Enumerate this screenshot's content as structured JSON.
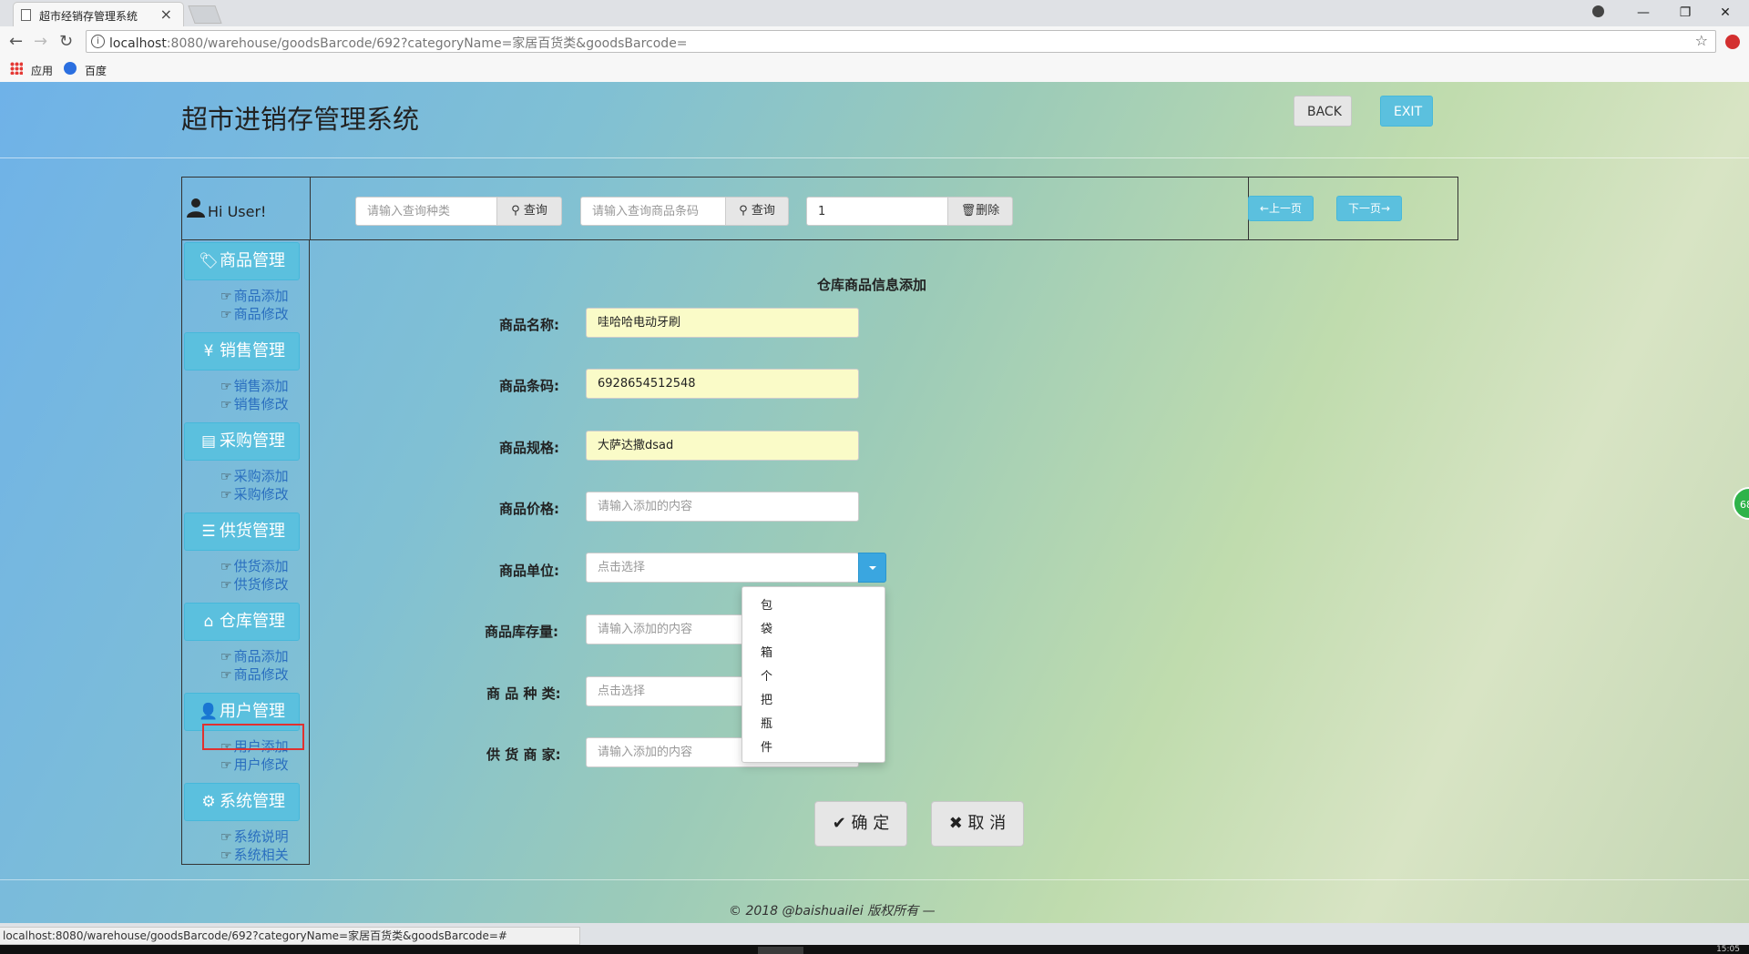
{
  "browser": {
    "tab_title": "超市经销存管理系统",
    "url_host": "localhost",
    "url_rest": ":8080/warehouse/goodsBarcode/692?categoryName=家居百货类&goodsBarcode=",
    "bookmarks": [
      "应用",
      "百度"
    ],
    "status_url": "localhost:8080/warehouse/goodsBarcode/692?categoryName=家居百货类&goodsBarcode=#",
    "clock": "15:05"
  },
  "header": {
    "title": "超市进销存管理系统",
    "back_label": "BACK",
    "exit_label": "EXIT"
  },
  "topbar": {
    "greeting": "Hi User!",
    "search_category_placeholder": "请输入查询种类",
    "search_category_button": "查询",
    "search_barcode_placeholder": "请输入查询商品条码",
    "search_barcode_button": "查询",
    "delete_value": "1",
    "delete_button": "删除",
    "prev_page": "上一页",
    "next_page": "下一页"
  },
  "sidebar": {
    "groups": [
      {
        "title": "商品管理",
        "icon": "tag-icon",
        "links": [
          "商品添加",
          "商品修改"
        ]
      },
      {
        "title": "销售管理",
        "icon": "yen-icon",
        "links": [
          "销售添加",
          "销售修改"
        ]
      },
      {
        "title": "采购管理",
        "icon": "list-alt-icon",
        "links": [
          "采购添加",
          "采购修改"
        ]
      },
      {
        "title": "供货管理",
        "icon": "list-icon",
        "links": [
          "供货添加",
          "供货修改"
        ]
      },
      {
        "title": "仓库管理",
        "icon": "home-icon",
        "links": [
          "商品添加",
          "商品修改"
        ]
      },
      {
        "title": "用户管理",
        "icon": "user-icon",
        "links": [
          "用户添加",
          "用户修改"
        ]
      },
      {
        "title": "系统管理",
        "icon": "cog-icon",
        "links": [
          "系统说明",
          "系统相关"
        ]
      }
    ]
  },
  "form": {
    "title": "仓库商品信息添加",
    "fields": [
      {
        "label": "商品名称:",
        "value": "哇哈哈电动牙刷",
        "placeholder": ""
      },
      {
        "label": "商品条码:",
        "value": "6928654512548",
        "placeholder": ""
      },
      {
        "label": "商品规格:",
        "value": "大萨达撒dsad",
        "placeholder": ""
      },
      {
        "label": "商品价格:",
        "value": "",
        "placeholder": "请输入添加的内容"
      },
      {
        "label": "商品单位:",
        "value": "",
        "placeholder": "点击选择"
      },
      {
        "label": "商品库存量:",
        "value": "",
        "placeholder": "请输入添加的内容"
      },
      {
        "label": "商 品 种 类:",
        "value": "",
        "placeholder": "点击选择"
      },
      {
        "label": "供 货 商 家:",
        "value": "",
        "placeholder": "请输入添加的内容"
      }
    ],
    "unit_options": [
      "包",
      "袋",
      "箱",
      "个",
      "把",
      "瓶",
      "件"
    ],
    "confirm_label": "确 定",
    "cancel_label": "取 消"
  },
  "footer": {
    "copyright": "© 2018 @baishuailei 版权所有 —"
  },
  "colors": {
    "accent": "#5bc0de",
    "link": "#2a6fbf",
    "highlight": "#e0312f",
    "filled_input": "#fafbc8"
  }
}
